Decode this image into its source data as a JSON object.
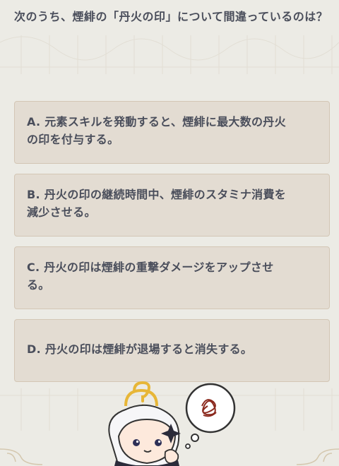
{
  "question": {
    "text": "次のうち、煙緋の「丹火の印」について間違っているのは？"
  },
  "options": [
    {
      "letter": "A",
      "text": "A. 元素スキルを発動すると、煙緋に最大数の丹火の印を付与する。"
    },
    {
      "letter": "B",
      "text": "B. 丹火の印の継続時間中、煙緋のスタミナ消費を減少させる。"
    },
    {
      "letter": "C",
      "text": "C. 丹火の印は煙緋の重撃ダメージをアップさせる。"
    },
    {
      "letter": "D",
      "text": "D. 丹火の印は煙緋が退場すると消失する。"
    }
  ],
  "mascot": {
    "icon": "paimon-thinking-icon",
    "thought_icon": "thought-bubble-icon"
  },
  "colors": {
    "background": "#ecebe5",
    "option_fill": "#e3dcd2",
    "option_border": "#d3c6b5",
    "text": "#4a4e5b"
  }
}
